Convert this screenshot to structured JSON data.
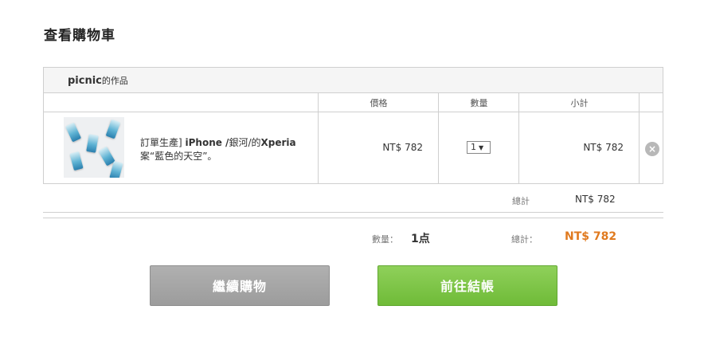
{
  "page": {
    "title": "查看購物車"
  },
  "shop": {
    "name": "picnic",
    "suffix": "的作品"
  },
  "table": {
    "headers": {
      "price": "價格",
      "quantity": "數量",
      "subtotal": "小計"
    }
  },
  "item": {
    "name_line1_prefix": "訂單生產] ",
    "name_line1_bold": "iPhone /",
    "name_line1_mid": "銀河/的",
    "name_line1_bold2": "Xperia",
    "name_line2": "案“藍色的天空”。",
    "price": "NT$ 782",
    "quantity": "1",
    "subtotal": "NT$ 782",
    "remove_symbol": "×"
  },
  "totals": {
    "label": "總計",
    "value": "NT$ 782"
  },
  "summary": {
    "quantity_label": "數量：",
    "quantity_value": "1点",
    "total_label": "總計：",
    "total_value": "NT$ 782"
  },
  "buttons": {
    "continue": "繼續購物",
    "checkout": "前往結帳"
  },
  "colors": {
    "checkout": "#6fbb38",
    "continue": "#9c9c9c",
    "total_accent": "#e07a1f"
  }
}
